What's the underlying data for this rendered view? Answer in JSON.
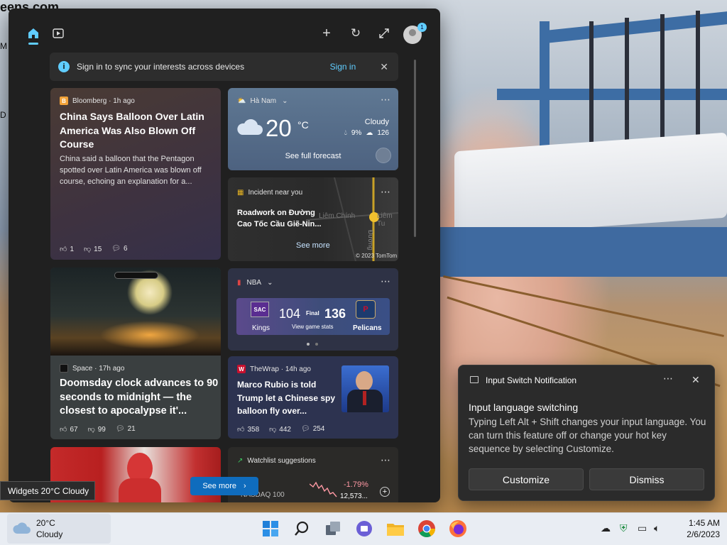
{
  "desktop": {
    "partial_text_top": "eens.com",
    "partial_text_m": "M",
    "partial_text_d": "D"
  },
  "widgets": {
    "signin_banner": {
      "text": "Sign in to sync your interests across devices",
      "link": "Sign in"
    },
    "news_1": {
      "source": "Bloomberg · 1h ago",
      "headline": "China Says Balloon Over Latin America Was Also Blown Off Course",
      "summary": "China said a balloon that the Pentagon spotted over Latin America was blown off course, echoing an explanation for a...",
      "likes": "1",
      "dislikes": "15",
      "comments": "6"
    },
    "weather": {
      "location": "Hà Nam",
      "temperature": "20",
      "unit": "°C",
      "condition": "Cloudy",
      "precip": "9%",
      "aqi": "126",
      "link": "See full forecast"
    },
    "incident": {
      "label": "Incident near you",
      "text": "Roadwork on Đường Cao Tốc Cầu Giẽ-Nin...",
      "link": "See more",
      "map_copyright": "© 2023 TomTom",
      "map_label_1": "Liêm Chính",
      "map_label_2": "Liêm Tu",
      "map_label_3": "Đường"
    },
    "news_2": {
      "source": "Space · 17h ago",
      "headline": "Doomsday clock advances to 90 seconds to midnight — the closest to apocalypse it'...",
      "likes": "67",
      "dislikes": "99",
      "comments": "21"
    },
    "nba": {
      "label": "NBA",
      "team1": "Kings",
      "team1_abbr": "SAC",
      "score1": "104",
      "status": "Final",
      "score2": "136",
      "team2": "Pelicans",
      "stats_link": "View game stats"
    },
    "news_3": {
      "source": "TheWrap · 14h ago",
      "headline": "Marco Rubio is told Trump let a Chinese spy balloon fly over...",
      "likes": "358",
      "dislikes": "442",
      "comments": "254"
    },
    "watchlist": {
      "label": "Watchlist suggestions",
      "ticker": "NASDAQ 100",
      "change": "-1.79%",
      "value": "12,573..."
    },
    "see_more": "See more"
  },
  "tooltip": "Widgets 20°C Cloudy",
  "notification": {
    "app": "Input Switch Notification",
    "title": "Input language switching",
    "body": "Typing Left Alt + Shift changes your input language. You can turn this feature off or change your hot key sequence by selecting Customize.",
    "customize": "Customize",
    "dismiss": "Dismiss"
  },
  "taskbar": {
    "weather_temp": "20°C",
    "weather_cond": "Cloudy",
    "time": "1:45 AM",
    "date": "2/6/2023"
  },
  "colors": {
    "accent": "#60cdff",
    "panel_bg": "#202020",
    "stock_down": "#ff99a4"
  }
}
